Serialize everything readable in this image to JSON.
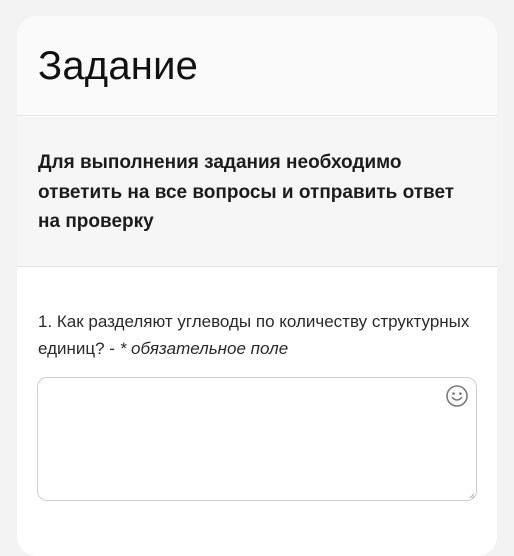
{
  "task": {
    "title": "Задание",
    "description": "Для выполнения задания необходимо ответить на все вопросы и отправить ответ на проверку"
  },
  "question": {
    "label": "1. Как разделяют углеводы по количеству структурных единиц? - ",
    "required_note": "* обязательное поле",
    "answer_value": "",
    "emoji_icon": "smiley-icon"
  },
  "colors": {
    "page_background": "#f3f3f3",
    "card_background": "#fafafa",
    "input_border": "#cfcfcf"
  }
}
